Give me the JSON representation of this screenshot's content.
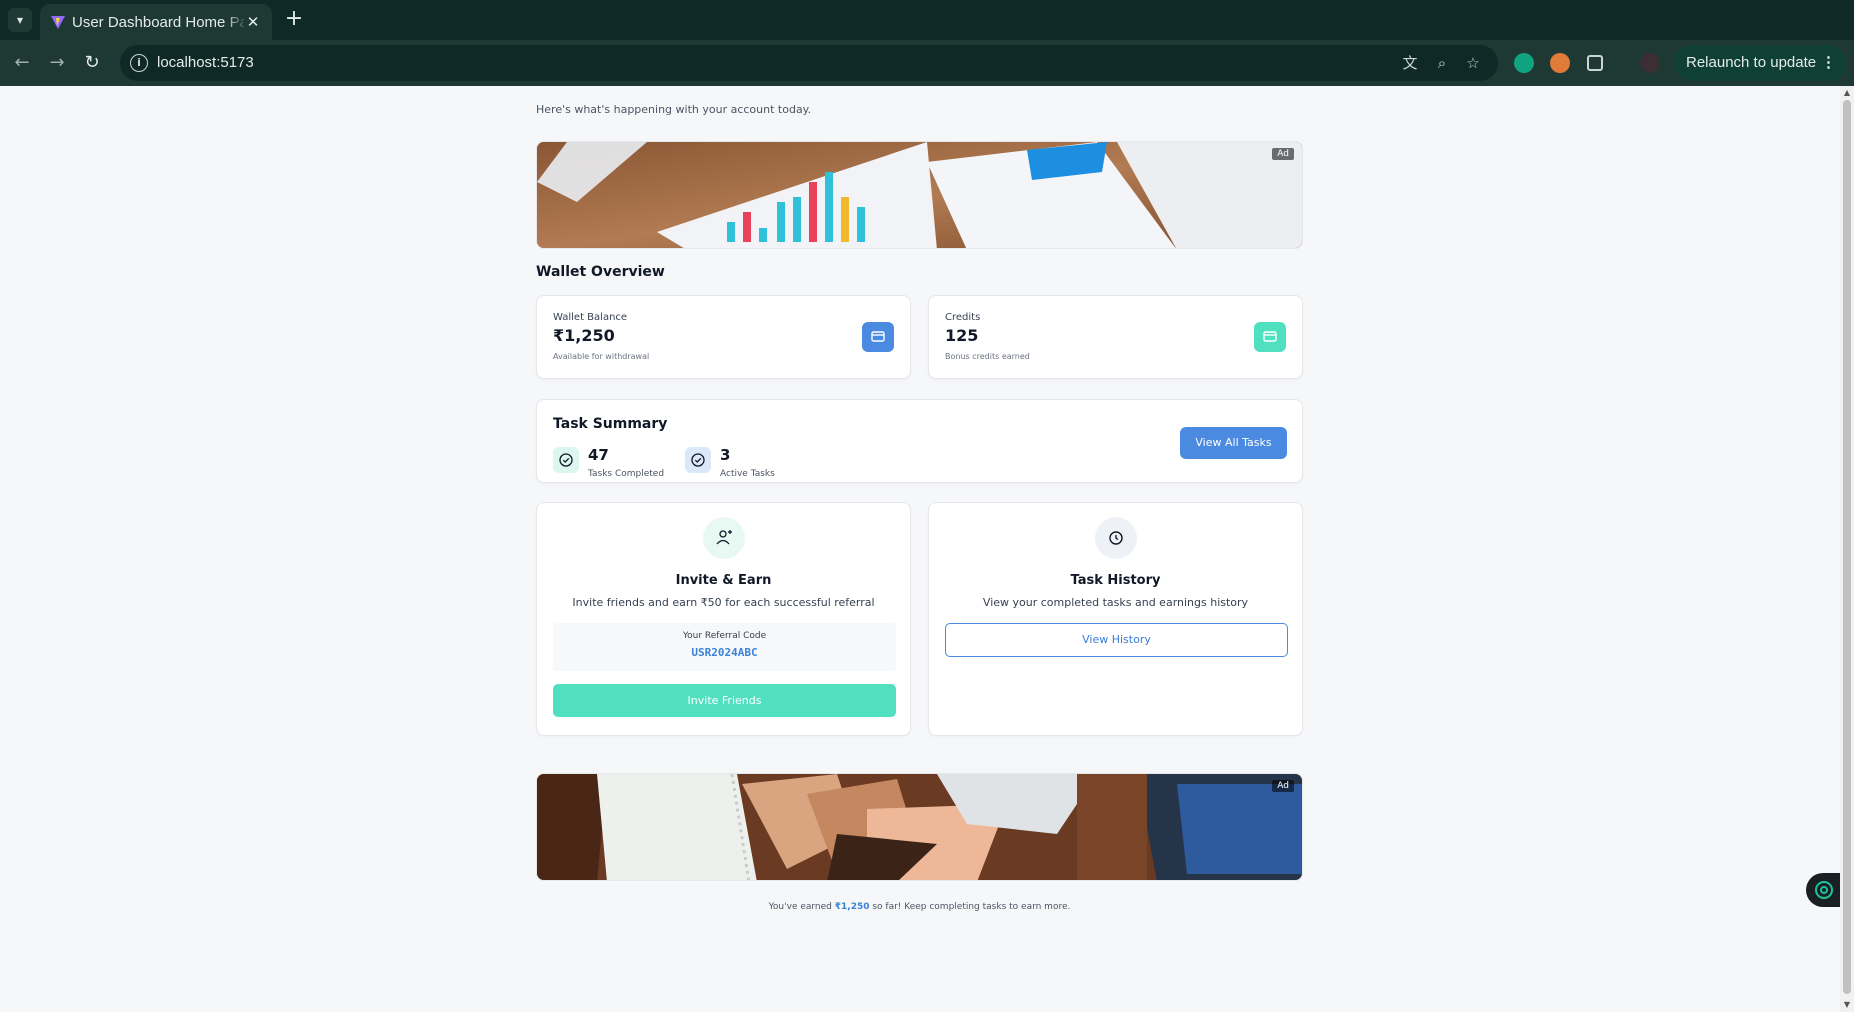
{
  "browser": {
    "tab_title": "User Dashboard Home Page",
    "tab_dropdown_icon": "chevron-down-icon",
    "url": "localhost:5173",
    "relaunch_label": "Relaunch to update",
    "relaunch_menu": "⋮"
  },
  "page": {
    "subtitle": "Here's what's happening with your account today.",
    "ad_label": "Ad",
    "wallet_section_title": "Wallet Overview",
    "wallet": {
      "label": "Wallet Balance",
      "value": "₹1,250",
      "sub": "Available for withdrawal",
      "icon": "credit-card-icon",
      "icon_color": "#4a8ae0"
    },
    "credits": {
      "label": "Credits",
      "value": "125",
      "sub": "Bonus credits earned",
      "icon": "credit-card-icon",
      "icon_color": "#50e0c0"
    },
    "task_summary": {
      "title": "Task Summary",
      "completed_value": "47",
      "completed_label": "Tasks Completed",
      "active_value": "3",
      "active_label": "Active Tasks",
      "view_all_label": "View All Tasks"
    },
    "invite": {
      "title": "Invite & Earn",
      "desc": "Invite friends and earn ₹50 for each successful referral",
      "ref_label": "Your Referral Code",
      "ref_code": "USR2024ABC",
      "button_label": "Invite Friends",
      "button_color": "#50e0c0"
    },
    "history": {
      "title": "Task History",
      "desc": "View your completed tasks and earnings history",
      "button_label": "View History"
    },
    "footer": {
      "prefix": "You've earned ",
      "amount": "₹1,250",
      "suffix": " so far! Keep completing tasks to earn more."
    }
  },
  "colors": {
    "accent_blue": "#4a8ae0",
    "accent_teal": "#50e0c0",
    "browser_dark": "#0f2a26"
  }
}
